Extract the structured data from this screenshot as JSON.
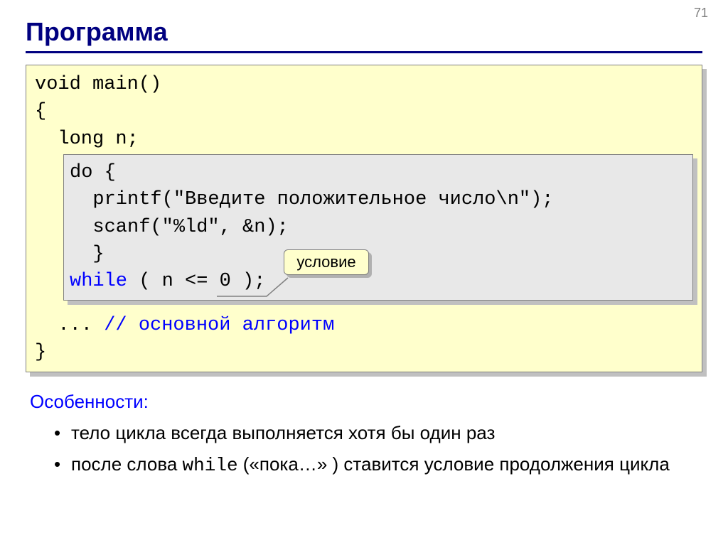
{
  "page_number": "71",
  "title": "Программа",
  "code": {
    "line1": "void main()",
    "line2": "{",
    "line3": "  long n;",
    "inner": {
      "l1": "do {",
      "l2": "  printf(\"Введите положительное число\\n\");",
      "l3": "  scanf(\"%ld\", &n);",
      "l4": "  }",
      "l5_a": "while",
      "l5_b": " ( n <= 0 );"
    },
    "line_after_a": "  ... ",
    "line_after_b": "// основной алгоритм",
    "line_close": "}"
  },
  "callout_label": "условие",
  "features": {
    "heading": "Особенности:",
    "bullet1": "тело цикла всегда выполняется хотя бы один раз",
    "bullet2_a": "после слова ",
    "bullet2_mono": "while",
    "bullet2_b": " («пока…» ) ставится условие продолжения цикла"
  }
}
